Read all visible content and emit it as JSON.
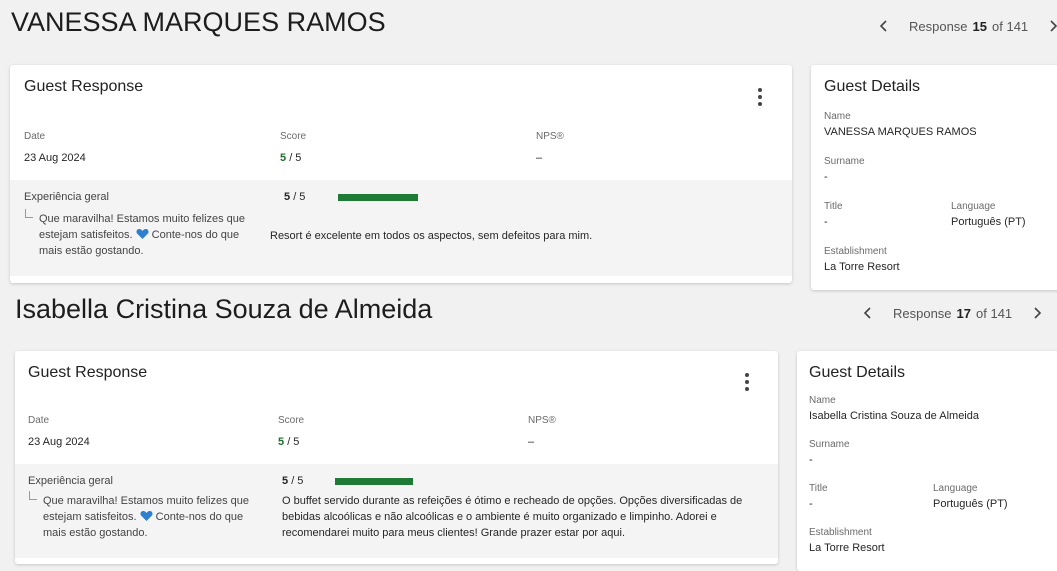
{
  "responses": [
    {
      "guest_name": "VANESSA MARQUES RAMOS",
      "pager": {
        "label": "Response",
        "current": "15",
        "of": "of 141"
      },
      "card": {
        "title": "Guest Response",
        "date_label": "Date",
        "date_value": "23 Aug 2024",
        "score_label": "Score",
        "score_value": "5",
        "score_total": "/ 5",
        "nps_label": "NPS®",
        "nps_value": "–",
        "question": "Experiência geral",
        "reply_line1": "Que maravilha! Estamos muito felizes que",
        "reply_line2_pre": "estejam satisfeitos.",
        "reply_line2_post": "Conte-nos do que",
        "reply_line3": "mais estão gostando.",
        "q_score": "5",
        "q_total": "/ 5",
        "q_fraction": 1.0,
        "comment": "Resort é excelente em todos os aspectos, sem defeitos para mim."
      },
      "details": {
        "title": "Guest Details",
        "name_label": "Name",
        "name_value": "VANESSA MARQUES RAMOS",
        "surname_label": "Surname",
        "surname_value": "-",
        "title_label": "Title",
        "title_value": "-",
        "language_label": "Language",
        "language_value": "Português (PT)",
        "establishment_label": "Establishment",
        "establishment_value": "La Torre Resort"
      }
    },
    {
      "guest_name": "Isabella Cristina Souza de Almeida",
      "pager": {
        "label": "Response",
        "current": "17",
        "of": "of 141"
      },
      "card": {
        "title": "Guest Response",
        "date_label": "Date",
        "date_value": "23 Aug 2024",
        "score_label": "Score",
        "score_value": "5",
        "score_total": "/ 5",
        "nps_label": "NPS®",
        "nps_value": "–",
        "question": "Experiência geral",
        "reply_line1": "Que maravilha! Estamos muito felizes que",
        "reply_line2_pre": "estejam satisfeitos.",
        "reply_line2_post": "Conte-nos do que",
        "reply_line3": "mais estão gostando.",
        "q_score": "5",
        "q_total": "/ 5",
        "q_fraction": 1.0,
        "comment_line1": "O buffet servido durante as refeições é ótimo e recheado de opções. Opções diversificadas de",
        "comment_line2": "bebidas alcoólicas e não alcoólicas e o ambiente é muito organizado e limpinho. Adorei e",
        "comment_line3": "recomendarei muito para meus clientes! Grande prazer estar por aqui."
      },
      "details": {
        "title": "Guest Details",
        "name_label": "Name",
        "name_value": "Isabella Cristina Souza de Almeida",
        "surname_label": "Surname",
        "surname_value": "-",
        "title_label": "Title",
        "title_value": "-",
        "language_label": "Language",
        "language_value": "Português (PT)",
        "establishment_label": "Establishment",
        "establishment_value": "La Torre Resort"
      }
    }
  ],
  "colors": {
    "score_green": "#1d6f2d",
    "bar_green": "#1f7a35",
    "heart_blue": "#2f7fd0"
  },
  "icons": [
    "chevron-left-icon",
    "chevron-right-icon",
    "more-vert-icon",
    "blue-heart-icon",
    "reply-corner-icon"
  ]
}
